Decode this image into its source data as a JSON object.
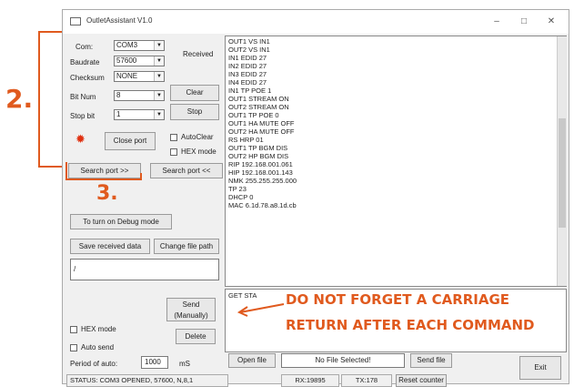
{
  "window": {
    "title": "OutletAssistant V1.0",
    "minimize": "–",
    "maximize": "□",
    "close": "✕"
  },
  "settings": {
    "com_label": "Com:",
    "com_value": "COM3",
    "baud_label": "Baudrate",
    "baud_value": "57600",
    "check_label": "Checksum",
    "check_value": "NONE",
    "bit_label": "Bit Num",
    "bit_value": "8",
    "stop_label": "Stop bit",
    "stop_value": "1",
    "close_port": "Close port"
  },
  "received": {
    "label": "Received",
    "clear": "Clear",
    "stop": "Stop",
    "auto_clear": "AutoClear",
    "hex_mode": "HEX mode",
    "lines": [
      "OUT1 VS IN1",
      "OUT2 VS IN1",
      "IN1 EDID 27",
      "IN2 EDID 27",
      "IN3 EDID 27",
      "IN4 EDID 27",
      "IN1 TP POE 1",
      "OUT1 STREAM ON",
      "OUT2 STREAM ON",
      "OUT1 TP POE 0",
      "OUT1 HA MUTE OFF",
      "OUT2 HA MUTE OFF",
      "RS HRP 01",
      "OUT1 TP BGM DIS",
      "OUT2 HP BGM DIS",
      "RIP 192.168.001.061",
      "HIP 192.168.001.143",
      "NMK 255.255.255.000",
      "TP 23",
      "DHCP 0",
      "MAC 6.1d.78.a8.1d.cb"
    ]
  },
  "search": {
    "left": "Search port >>",
    "right": "Search port <<"
  },
  "debug_button": "To turn on Debug mode",
  "save_received": "Save received data",
  "change_path": "Change file path",
  "path_value": "/",
  "send": {
    "text_value": "GET STA",
    "send_button": "Send (Manually)",
    "delete": "Delete",
    "hex_mode": "HEX mode",
    "auto_send": "Auto send",
    "period_label": "Period of auto:",
    "period_value": "1000",
    "period_unit": "mS"
  },
  "file": {
    "open": "Open file",
    "status": "No File Selected!",
    "send_file": "Send file"
  },
  "exit": "Exit",
  "statusbar": {
    "status": "STATUS: COM3 OPENED, 57600, N,8,1",
    "rx": "RX:19895",
    "tx": "TX:178",
    "reset": "Reset counter"
  },
  "annotations": {
    "step2": "2.",
    "step3": "3.",
    "note_line1": "DO NOT FORGET A CARRIAGE",
    "note_line2": "RETURN AFTER EACH COMMAND",
    "accent": "#e05a1e"
  }
}
